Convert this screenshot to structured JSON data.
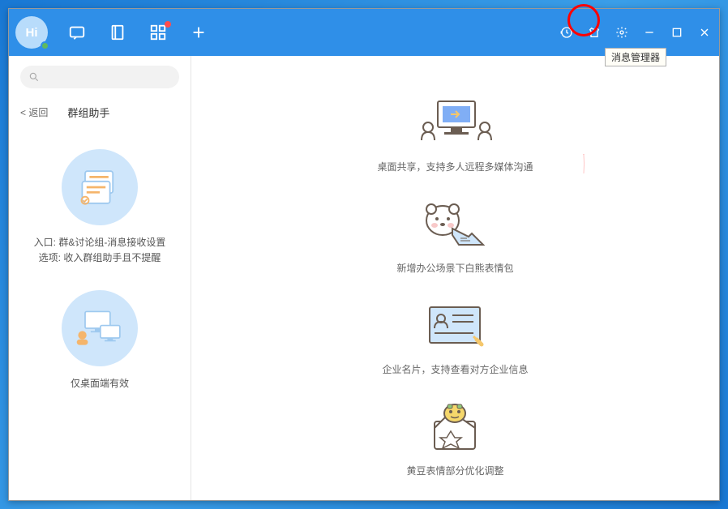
{
  "avatar": {
    "text": "Hi"
  },
  "tooltip": "消息管理器",
  "search": {
    "placeholder": ""
  },
  "sidebar": {
    "back": "返回",
    "title": "群组助手",
    "feature1_line1": "入口: 群&讨论组-消息接收设置",
    "feature1_line2": "选项: 收入群组助手且不提醒",
    "feature2": "仅桌面端有效"
  },
  "promos": [
    {
      "text": "桌面共享，支持多人远程多媒体沟通"
    },
    {
      "text": "新增办公场景下白熊表情包"
    },
    {
      "text": "企业名片，支持查看对方企业信息"
    },
    {
      "text": "黄豆表情部分优化调整"
    }
  ]
}
